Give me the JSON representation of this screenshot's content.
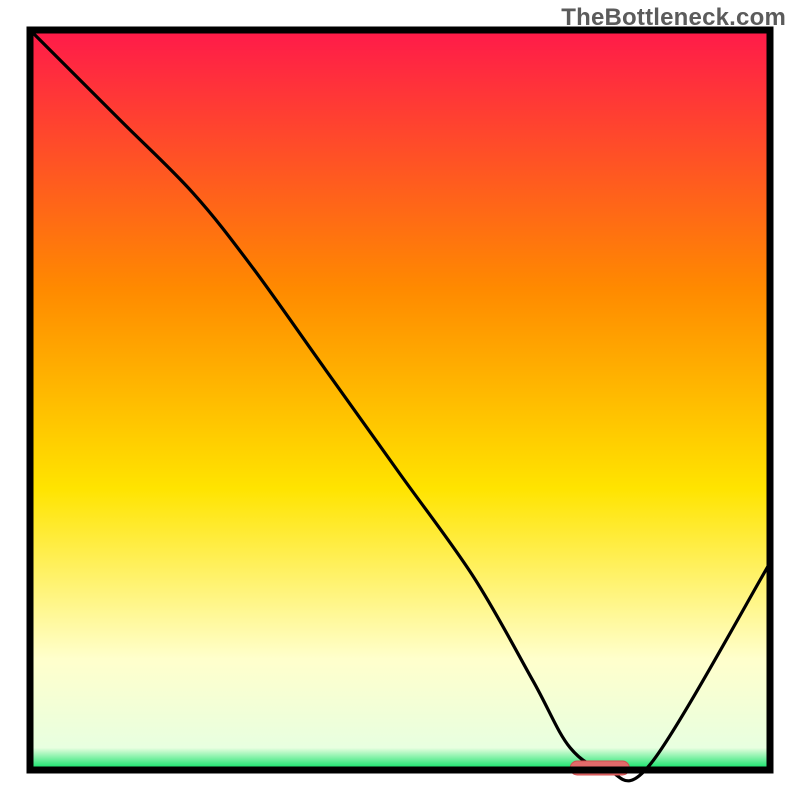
{
  "watermark": "TheBottleneck.com",
  "colors": {
    "frame": "#000000",
    "curve": "#000000",
    "marker_fill": "#e26a6a",
    "marker_stroke": "#d24f4f",
    "grad_top": "#ff1a4a",
    "grad_mid1": "#ff8a00",
    "grad_mid2": "#ffe400",
    "grad_pale": "#ffffcc",
    "grad_green": "#00e060"
  },
  "chart_data": {
    "type": "line",
    "title": "",
    "xlabel": "",
    "ylabel": "",
    "xlim": [
      0,
      100
    ],
    "ylim": [
      0,
      100
    ],
    "x": [
      0,
      12,
      22,
      30,
      40,
      50,
      60,
      68,
      73,
      78,
      84,
      100
    ],
    "values": [
      100,
      88,
      78,
      68,
      54,
      40,
      26,
      12,
      3,
      0,
      1,
      28
    ],
    "marker": {
      "x_start": 73,
      "x_end": 81,
      "y": 0
    },
    "annotations": []
  }
}
